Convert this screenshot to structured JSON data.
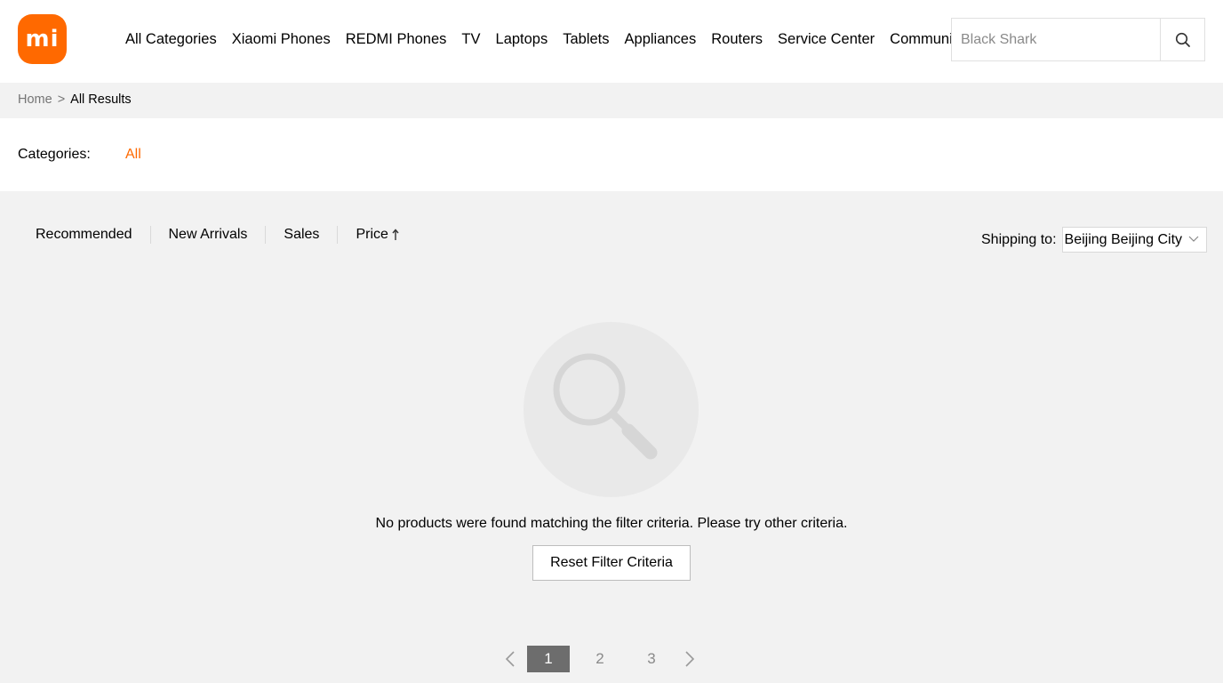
{
  "header": {
    "logo_text": "mi",
    "brand_color": "#ff6900",
    "nav": [
      "All Categories",
      "Xiaomi Phones",
      "REDMI Phones",
      "TV",
      "Laptops",
      "Tablets",
      "Appliances",
      "Routers",
      "Service Center",
      "Community"
    ],
    "search": {
      "placeholder": "Black Shark",
      "icon": "search-icon"
    }
  },
  "breadcrumb": {
    "home": "Home",
    "separator": ">",
    "current": "All Results"
  },
  "categories": {
    "label": "Categories:",
    "selected": "All"
  },
  "sort": {
    "options": [
      "Recommended",
      "New Arrivals",
      "Sales",
      "Price"
    ],
    "price_icon": "arrow-up-icon"
  },
  "shipping": {
    "label": "Shipping to:",
    "value": "Beijing Beijing City"
  },
  "empty_state": {
    "icon": "magnifier-icon",
    "message": "No products were found matching the filter criteria. Please try other criteria.",
    "reset_label": "Reset Filter Criteria"
  },
  "pagination": {
    "pages": [
      "1",
      "2",
      "3"
    ],
    "current": "1"
  }
}
